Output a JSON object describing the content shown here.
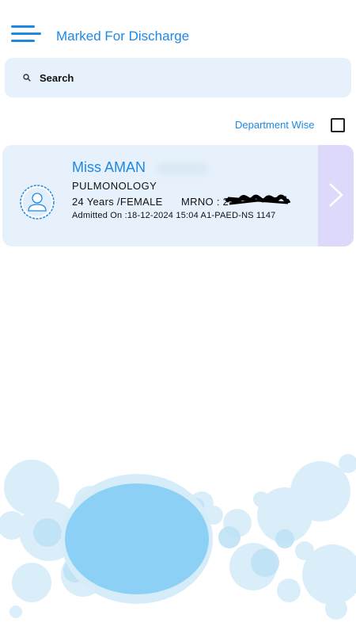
{
  "header": {
    "title": "Marked For Discharge",
    "menu_icon": "hamburger-menu-icon"
  },
  "search": {
    "placeholder": "Search",
    "icon": "search-icon"
  },
  "filter": {
    "label": "Department Wise",
    "checked": false
  },
  "patients": [
    {
      "name": "Miss AMAN",
      "department": "PULMONOLOGY",
      "age_gender": "24 Years /FEMALE",
      "mrno_label": "MRNO : ",
      "mrno_value": "2",
      "admitted": "Admitted On :18-12-2024 15:04  A1-PAED-NS 1147"
    }
  ],
  "colors": {
    "accent": "#1e88e5",
    "card_bg": "#e6f1fb",
    "arrow_bg": "#dcd9fb"
  }
}
